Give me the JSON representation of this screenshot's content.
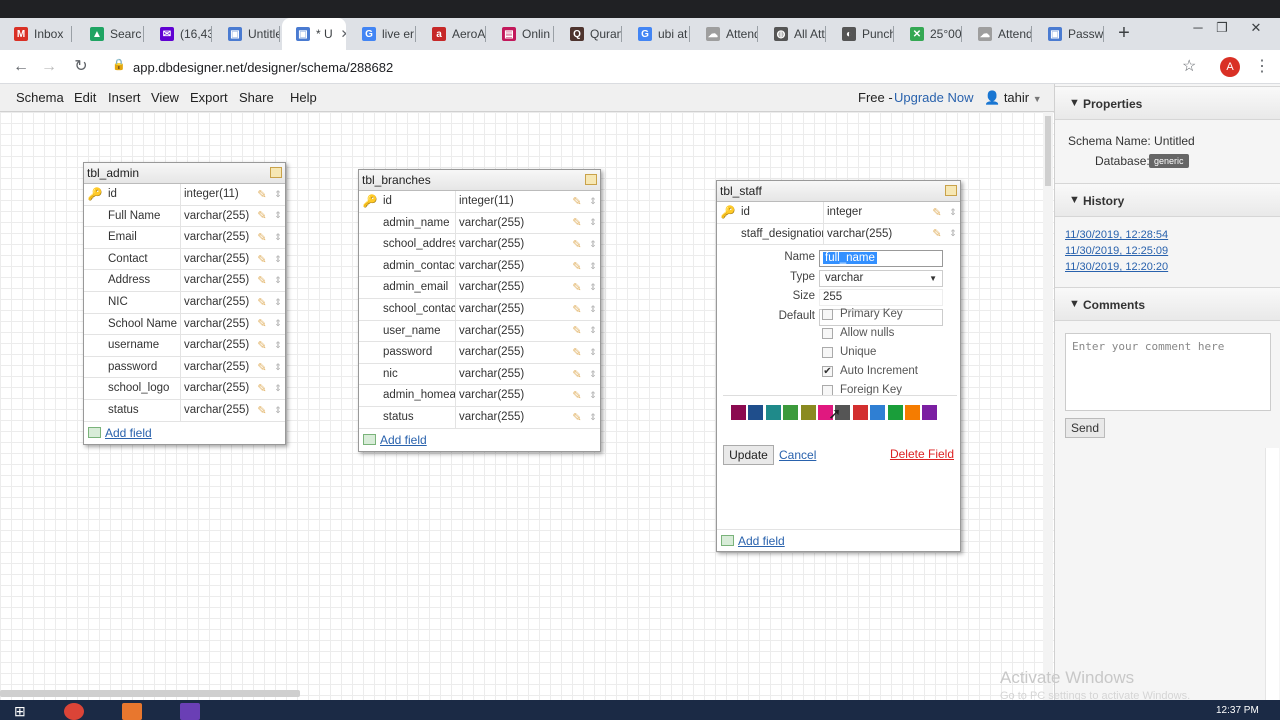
{
  "browser": {
    "tabs": [
      {
        "label": "Inbox",
        "icon": "gmail-icon",
        "color": "#d93025",
        "glyph": "M"
      },
      {
        "label": "Searc",
        "icon": "drive-icon",
        "color": "#1fa463",
        "glyph": "▲"
      },
      {
        "label": "(16,43",
        "icon": "yahoo-mail-icon",
        "color": "#6001d2",
        "glyph": "✉"
      },
      {
        "label": "Untitle",
        "icon": "dbdesigner-icon",
        "color": "#4a7bd1",
        "glyph": "▣"
      },
      {
        "label": "* U",
        "icon": "dbdesigner-icon",
        "color": "#4a7bd1",
        "glyph": "▣"
      },
      {
        "label": "live er",
        "icon": "google-icon",
        "color": "#4285f4",
        "glyph": "G"
      },
      {
        "label": "AeroA",
        "icon": "aero-icon",
        "color": "#c62828",
        "glyph": "a"
      },
      {
        "label": "Onlin",
        "icon": "online-icon",
        "color": "#c2185b",
        "glyph": "▤"
      },
      {
        "label": "Quran",
        "icon": "quran-icon",
        "color": "#4e342e",
        "glyph": "Q"
      },
      {
        "label": "ubi at",
        "icon": "google-icon",
        "color": "#4285f4",
        "glyph": "G"
      },
      {
        "label": "Attend",
        "icon": "attendance-icon",
        "color": "#9e9e9e",
        "glyph": "☁"
      },
      {
        "label": "All Att",
        "icon": "globe-icon",
        "color": "#555555",
        "glyph": "◍"
      },
      {
        "label": "Punch",
        "icon": "punch-icon",
        "color": "#555555",
        "glyph": "◐"
      },
      {
        "label": "25°00",
        "icon": "maps-icon",
        "color": "#34a853",
        "glyph": "✕"
      },
      {
        "label": "Attend",
        "icon": "attendance-icon",
        "color": "#9e9e9e",
        "glyph": "☁"
      },
      {
        "label": "Passw",
        "icon": "password-icon",
        "color": "#4a7bd1",
        "glyph": "▣"
      }
    ],
    "new_tab": "+",
    "url": "app.dbdesigner.net/designer/schema/288682",
    "profile_initial": "A"
  },
  "menubar": {
    "items": [
      "Schema",
      "Edit",
      "Insert",
      "View",
      "Export",
      "Share",
      "Help"
    ],
    "free": "Free -",
    "upgrade": "Upgrade Now",
    "user": "tahir"
  },
  "tables": {
    "admin": {
      "name": "tbl_admin",
      "rows": [
        {
          "name": "id",
          "type": "integer(11)",
          "key": true
        },
        {
          "name": "Full Name",
          "type": "varchar(255)"
        },
        {
          "name": "Email",
          "type": "varchar(255)"
        },
        {
          "name": "Contact",
          "type": "varchar(255)"
        },
        {
          "name": "Address",
          "type": "varchar(255)"
        },
        {
          "name": "NIC",
          "type": "varchar(255)"
        },
        {
          "name": "School Name",
          "type": "varchar(255)"
        },
        {
          "name": "username",
          "type": "varchar(255)"
        },
        {
          "name": "password",
          "type": "varchar(255)"
        },
        {
          "name": "school_logo",
          "type": "varchar(255)"
        },
        {
          "name": "status",
          "type": "varchar(255)"
        }
      ]
    },
    "branches": {
      "name": "tbl_branches",
      "rows": [
        {
          "name": "id",
          "type": "integer(11)",
          "key": true
        },
        {
          "name": "admin_name",
          "type": "varchar(255)"
        },
        {
          "name": "school_address",
          "type": "varchar(255)"
        },
        {
          "name": "admin_contact",
          "type": "varchar(255)"
        },
        {
          "name": "admin_email",
          "type": "varchar(255)"
        },
        {
          "name": "school_contact",
          "type": "varchar(255)"
        },
        {
          "name": "user_name",
          "type": "varchar(255)"
        },
        {
          "name": "password",
          "type": "varchar(255)"
        },
        {
          "name": "nic",
          "type": "varchar(255)"
        },
        {
          "name": "admin_homeaddress",
          "type": "varchar(255)"
        },
        {
          "name": "status",
          "type": "varchar(255)"
        }
      ]
    },
    "staff": {
      "name": "tbl_staff",
      "rows": [
        {
          "name": "id",
          "type": "integer",
          "key": true
        },
        {
          "name": "staff_designation",
          "type": "varchar(255)"
        }
      ]
    },
    "add_field_label": "Add field"
  },
  "field_editor": {
    "name_label": "Name",
    "name_value": "full_name",
    "type_label": "Type",
    "type_value": "varchar",
    "size_label": "Size",
    "size_value": "255",
    "default_label": "Default",
    "default_value": "",
    "options": [
      {
        "label": "Primary Key",
        "checked": false
      },
      {
        "label": "Allow nulls",
        "checked": false
      },
      {
        "label": "Unique",
        "checked": false
      },
      {
        "label": "Auto Increment",
        "checked": true
      },
      {
        "label": "Foreign Key",
        "checked": false
      }
    ],
    "colors": [
      "#8b0a50",
      "#1f4e8c",
      "#1f8a8a",
      "#3c9a3c",
      "#8a8a20",
      "#e0187f",
      "#555555",
      "#d32f2f",
      "#2f7fd3",
      "#1a9e3a",
      "#f57c00",
      "#7b1fa2",
      "#ffffff"
    ],
    "update": "Update",
    "cancel": "Cancel",
    "delete": "Delete Field"
  },
  "sidebar": {
    "properties_title": "Properties",
    "schema_name": "Schema Name: Untitled",
    "database_label": "Database:",
    "database_value": "generic",
    "history_title": "History",
    "history": [
      "11/30/2019, 12:28:54",
      "11/30/2019, 12:25:09",
      "11/30/2019, 12:20:20"
    ],
    "comments_title": "Comments",
    "comment_placeholder": "Enter your comment here",
    "send": "Send"
  },
  "watermark": {
    "title": "Activate Windows",
    "subtitle": "Go to PC settings to activate Windows."
  },
  "taskbar": {
    "clock": "12:37 PM"
  }
}
